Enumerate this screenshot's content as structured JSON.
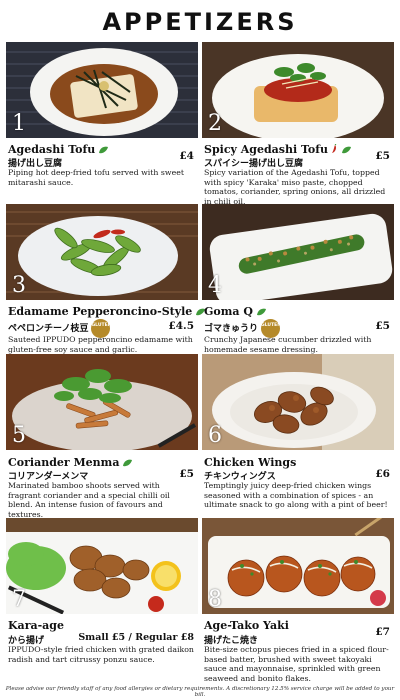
{
  "menu": {
    "title": "APPETIZERS",
    "footer": "Please advise our friendly staff of any food allergies or dietary requirements. A discretionary 12.5% service charge will be added to your bill."
  },
  "items": [
    {
      "number": "1",
      "name": "Agedashi Tofu",
      "jp": "揚げ出し豆腐",
      "price": "£4",
      "desc": "Piping hot deep-fried tofu served with sweet mitarashi sauce.",
      "vegetarian": true
    },
    {
      "number": "2",
      "name": "Spicy Agedashi Tofu",
      "jp": "スパイシー揚げ出し豆腐",
      "price": "£5",
      "desc": "Spicy variation of the Agedashi Tofu, topped with spicy 'Karaka' miso paste, chopped tomatos, coriander, spring onions, all drizzled in chili oil.",
      "vegetarian": true,
      "spicy": true
    },
    {
      "number": "3",
      "name": "Edamame Pepperoncino-Style",
      "jp": "ペペロンチーノ枝豆",
      "price": "£4.5",
      "desc": "Sauteed IPPUDO pepperoncino edamame with gluten-free soy sauce and garlic.",
      "vegetarian": true,
      "gluten_free": true,
      "badge_text": "GLUTEN FREE"
    },
    {
      "number": "4",
      "name": "Goma Q",
      "jp": "ゴマきゅうり",
      "price": "£5",
      "desc": "Crunchy Japanese cucumber drizzled with homemade sesame dressing.",
      "vegetarian": true,
      "gluten_free": true,
      "badge_text": "GLUTEN FREE"
    },
    {
      "number": "5",
      "name": "Coriander Menma",
      "jp": "コリアンダーメンマ",
      "price": "£5",
      "desc": "Marinated bamboo shoots served with fragrant coriander and a special chilli oil blend. An intense fusion of favours and textures.",
      "vegetarian": true
    },
    {
      "number": "6",
      "name": "Chicken Wings",
      "jp": "チキンウィングス",
      "price": "£6",
      "desc": "Temptingly juicy deep-fried chicken wings seasoned with a combination of spices - an ultimate snack to go along with a pint of beer!"
    },
    {
      "number": "7",
      "name": "Kara-age",
      "jp": "から揚げ",
      "price": "Small £5 / Regular £8",
      "desc": "IPPUDO-style fried chicken with grated daikon radish and tart citrussy ponzu sauce."
    },
    {
      "number": "8",
      "name": "Age-Tako Yaki",
      "jp": "揚げたこ焼き",
      "price": "£7",
      "desc": "Bite-size octopus pieces fried in a spiced flour-based batter, brushed with sweet takoyaki sauce and mayonnaise, sprinkled with green seaweed and bonito flakes."
    }
  ],
  "colors": {
    "leaf": "#3f9a3a",
    "chili": "#c4281d",
    "badge": "#b58a2a"
  },
  "icons": {
    "vegetarian": "leaf-icon",
    "spicy": "chili-icon",
    "gluten_free": "gluten-free-badge"
  }
}
